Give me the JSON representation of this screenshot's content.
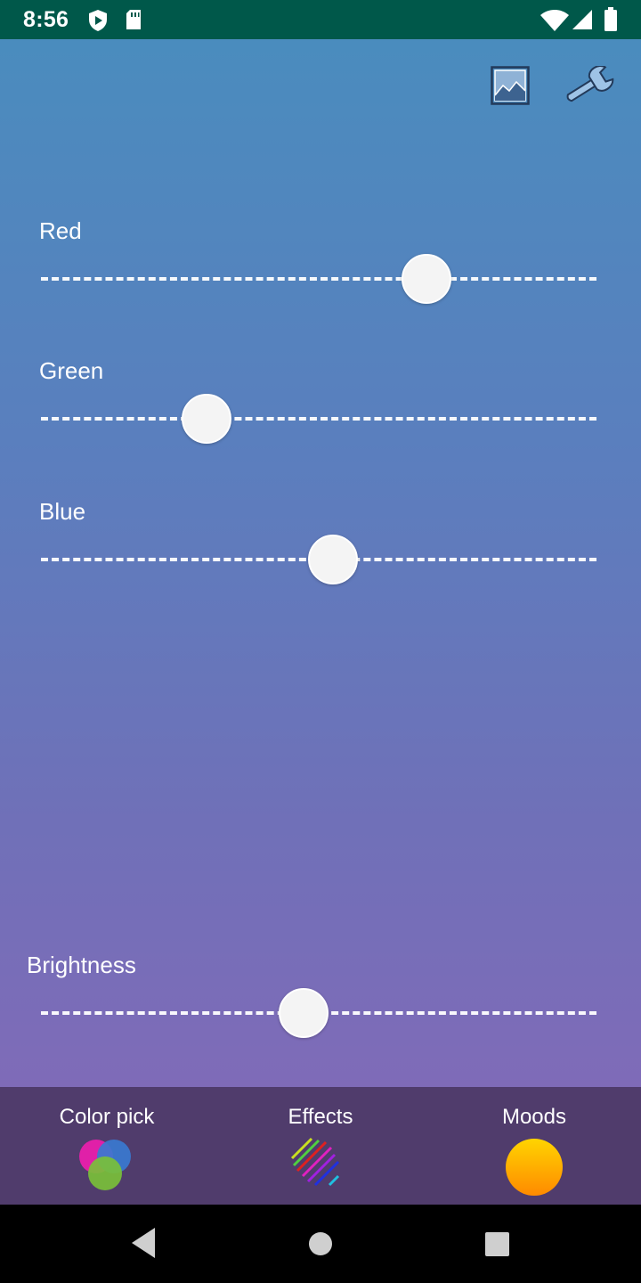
{
  "status_bar": {
    "time": "8:56",
    "icons": [
      "play-protect-icon",
      "sd-card-icon",
      "wifi-icon",
      "cell-signal-icon",
      "battery-icon"
    ]
  },
  "toolbar": {
    "icons": [
      "image-icon",
      "wrench-icon"
    ]
  },
  "sliders": [
    {
      "label": "Red",
      "value": 0.69
    },
    {
      "label": "Green",
      "value": 0.295
    },
    {
      "label": "Blue",
      "value": 0.522
    }
  ],
  "brightness": {
    "label": "Brightness",
    "value": 0.47
  },
  "bottom_tabs": [
    {
      "label": "Color pick",
      "icon": "color-pick-icon"
    },
    {
      "label": "Effects",
      "icon": "effects-icon"
    },
    {
      "label": "Moods",
      "icon": "moods-icon"
    }
  ],
  "nav": {
    "icons": [
      "back-icon",
      "home-icon",
      "recents-icon"
    ]
  },
  "colors": {
    "status_bar": "#00584a",
    "gradient_top": "#4a8cbe",
    "gradient_bottom": "#7f6bb8",
    "bottom_bar": "#503c6c",
    "mood_yellow": "#ffd400",
    "mood_orange": "#ff8a00"
  }
}
